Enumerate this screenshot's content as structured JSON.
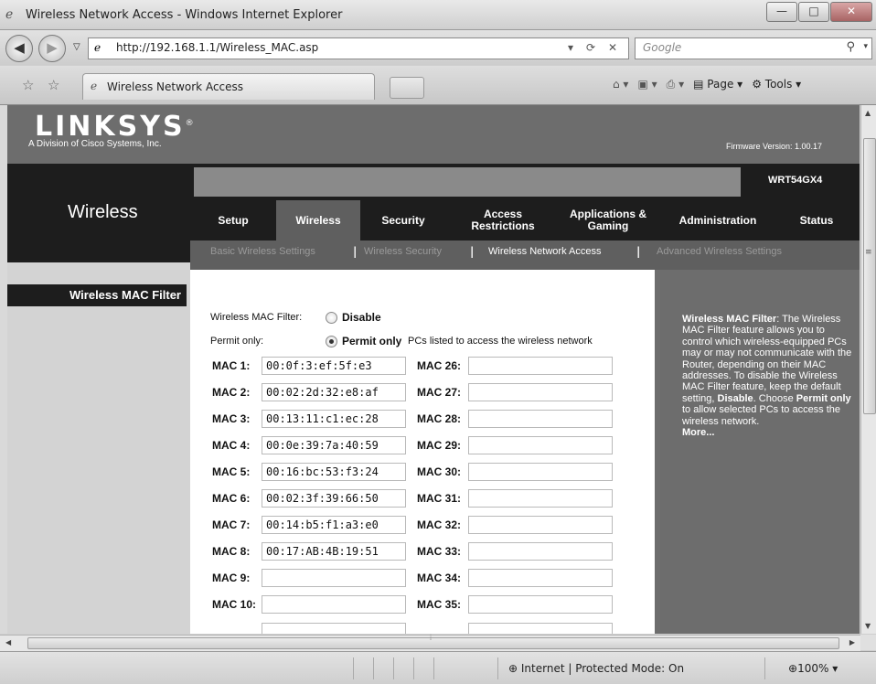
{
  "browser": {
    "window_title": "Wireless Network Access - Windows Internet Explorer",
    "url": "http://192.168.1.1/Wireless_MAC.asp",
    "search_placeholder": "Google",
    "tab_title": "Wireless Network Access",
    "cmd_page": "Page",
    "cmd_tools": "Tools",
    "status_zone": "Internet | Protected Mode: On",
    "zoom": "100%"
  },
  "header": {
    "logo": "LINKSYS",
    "logo_reg": "®",
    "logo_sub": "A Division of Cisco Systems, Inc.",
    "firmware": "Firmware Version: 1.00.17",
    "model": "WRT54GX4",
    "section": "Wireless"
  },
  "menu": [
    {
      "label": "Setup"
    },
    {
      "label": "Wireless"
    },
    {
      "label": "Security"
    },
    {
      "label": "Access Restrictions"
    },
    {
      "label": "Applications & Gaming"
    },
    {
      "label": "Administration"
    },
    {
      "label": "Status"
    }
  ],
  "submenu": [
    {
      "label": "Basic Wireless Settings"
    },
    {
      "label": "Wireless Security"
    },
    {
      "label": "Wireless Network Access"
    },
    {
      "label": "Advanced Wireless Settings"
    }
  ],
  "left_label": "Wireless MAC Filter",
  "form": {
    "filter_label": "Wireless MAC Filter:",
    "disable_label": "Disable",
    "permit_prefix": "Permit only:",
    "permit_label": "Permit only",
    "permit_desc": "PCs listed to access the wireless network",
    "left_macs": [
      {
        "label": "MAC 1:",
        "value": "00:0f:3:ef:5f:e3"
      },
      {
        "label": "MAC 2:",
        "value": "00:02:2d:32:e8:af"
      },
      {
        "label": "MAC 3:",
        "value": "00:13:11:c1:ec:28"
      },
      {
        "label": "MAC 4:",
        "value": "00:0e:39:7a:40:59"
      },
      {
        "label": "MAC 5:",
        "value": "00:16:bc:53:f3:24"
      },
      {
        "label": "MAC 6:",
        "value": "00:02:3f:39:66:50"
      },
      {
        "label": "MAC 7:",
        "value": "00:14:b5:f1:a3:e0"
      },
      {
        "label": "MAC 8:",
        "value": "00:17:AB:4B:19:51"
      },
      {
        "label": "MAC 9:",
        "value": ""
      },
      {
        "label": "MAC 10:",
        "value": ""
      }
    ],
    "right_macs": [
      {
        "label": "MAC 26:",
        "value": ""
      },
      {
        "label": "MAC 27:",
        "value": ""
      },
      {
        "label": "MAC 28:",
        "value": ""
      },
      {
        "label": "MAC 29:",
        "value": ""
      },
      {
        "label": "MAC 30:",
        "value": ""
      },
      {
        "label": "MAC 31:",
        "value": ""
      },
      {
        "label": "MAC 32:",
        "value": ""
      },
      {
        "label": "MAC 33:",
        "value": ""
      },
      {
        "label": "MAC 34:",
        "value": ""
      },
      {
        "label": "MAC 35:",
        "value": ""
      }
    ]
  },
  "help": {
    "title": "Wireless MAC Filter",
    "text1": ": The Wireless MAC Filter feature allows you to control which wireless-equipped PCs may or may not communicate with the Router, depending on their MAC addresses. To disable the Wireless MAC Filter feature, keep the default setting, ",
    "disable": "Disable",
    "text2": ". Choose ",
    "permit": "Permit only",
    "text3": " to allow selected PCs to access the wireless network.",
    "more": "More..."
  }
}
